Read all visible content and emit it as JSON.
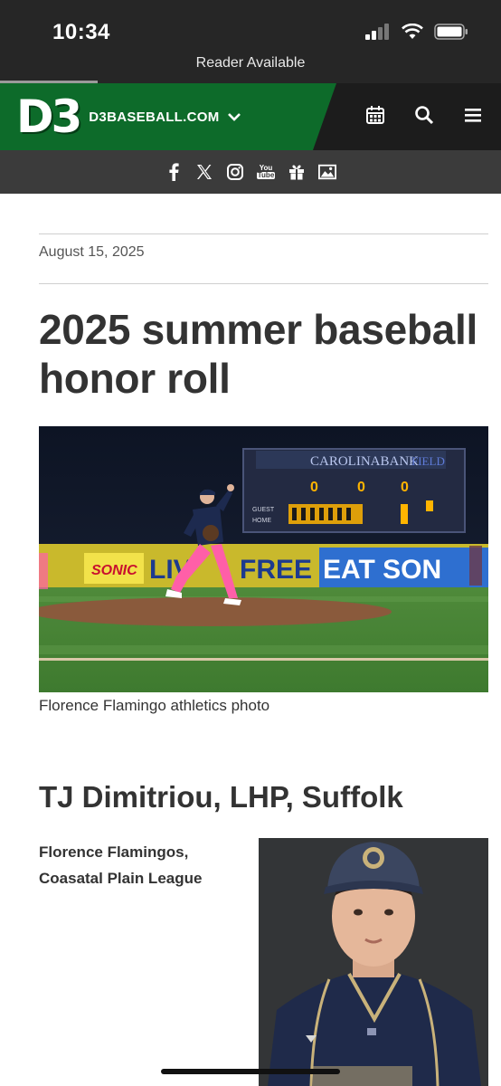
{
  "status": {
    "time": "10:34",
    "reader_label": "Reader Available"
  },
  "header": {
    "logo_text": "D3",
    "site_name": "D3BASEBALL.COM",
    "brand_color": "#0d6b2a",
    "actions": [
      "calendar-icon",
      "search-icon",
      "menu-icon"
    ]
  },
  "social": [
    "facebook-icon",
    "x-icon",
    "instagram-icon",
    "youtube-icon",
    "gift-icon",
    "image-icon"
  ],
  "youtube_label": [
    "You",
    "Tube"
  ],
  "article": {
    "date": "August 15, 2025",
    "title_lines": [
      "2025 summer baseball",
      "honor roll"
    ],
    "hero_caption": "Florence Flamingo athletics photo",
    "scoreboard_sponsor": "CAROLINABANK",
    "scoreboard_sponsor_suffix": "FIELD",
    "scoreboard_rows": [
      "GUEST",
      "HOME"
    ],
    "banner_texts": [
      "SONIC",
      "LIV",
      "FREE",
      "EAT SON"
    ],
    "player": {
      "heading": "TJ Dimitriou, LHP, Suffolk",
      "team_lines": [
        "Florence Flamingos,",
        "Coasatal Plain League"
      ]
    }
  }
}
